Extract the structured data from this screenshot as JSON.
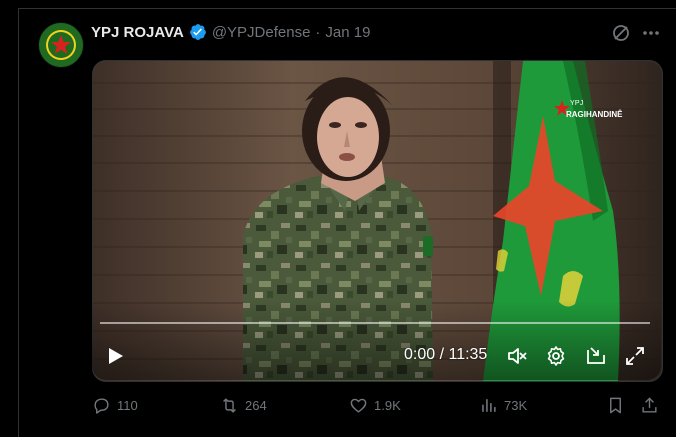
{
  "tweet": {
    "author_name": "YPJ ROJAVA",
    "handle": "@YPJDefense",
    "separator": "·",
    "date": "Jan 19",
    "verified": true,
    "accent_color": "#1d9bf0"
  },
  "video": {
    "watermark_line1": "YPJ",
    "watermark_line2": "RAGIHANDINÊ",
    "current_time": "0:00",
    "duration": "11:35",
    "time_display": "0:00 / 11:35",
    "progress": 0,
    "muted": true
  },
  "actions": {
    "replies": "110",
    "reposts": "264",
    "likes": "1.9K",
    "views": "73K"
  },
  "colors": {
    "background": "#000000",
    "text_primary": "#e7e9ea",
    "text_secondary": "#71767b",
    "border": "#2f3336"
  }
}
